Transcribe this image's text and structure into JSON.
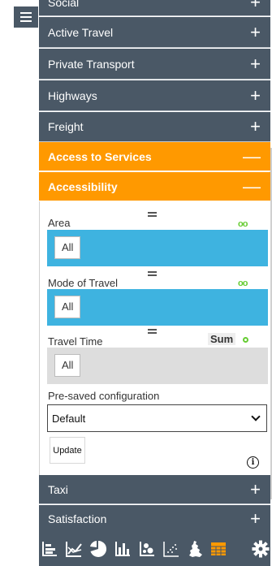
{
  "accordion": {
    "items": [
      {
        "label": "Social",
        "toggle": "+"
      },
      {
        "label": "Active Travel",
        "toggle": "+"
      },
      {
        "label": "Private Transport",
        "toggle": "+"
      },
      {
        "label": "Highways",
        "toggle": "+"
      },
      {
        "label": "Freight",
        "toggle": "+"
      },
      {
        "label": "Access to Services",
        "toggle": "—"
      },
      {
        "label": "Accessibility",
        "toggle": "—"
      },
      {
        "label": "Taxi",
        "toggle": "+"
      },
      {
        "label": "Satisfaction",
        "toggle": "+"
      }
    ]
  },
  "filters": {
    "area": {
      "label": "Area",
      "value": "All"
    },
    "mode": {
      "label": "Mode of Travel",
      "value": "All"
    },
    "time": {
      "label": "Travel Time",
      "value": "All",
      "agg": "Sum"
    }
  },
  "config": {
    "label": "Pre-saved configuration",
    "selected": "Default",
    "update_label": "Update",
    "info_glyph": "i"
  },
  "toolbar": {
    "icons": [
      "stacked-bar-icon",
      "line-chart-icon",
      "pie-chart-icon",
      "bar-chart-icon",
      "bubble-chart-icon",
      "scatter-plot-icon",
      "map-icon",
      "table-icon",
      "settings-gear-icon"
    ]
  },
  "colors": {
    "panel_grey": "#4a5866",
    "active_orange": "#ff9900",
    "filter_blue": "#3eb3e0",
    "link_green": "#66cc33"
  }
}
